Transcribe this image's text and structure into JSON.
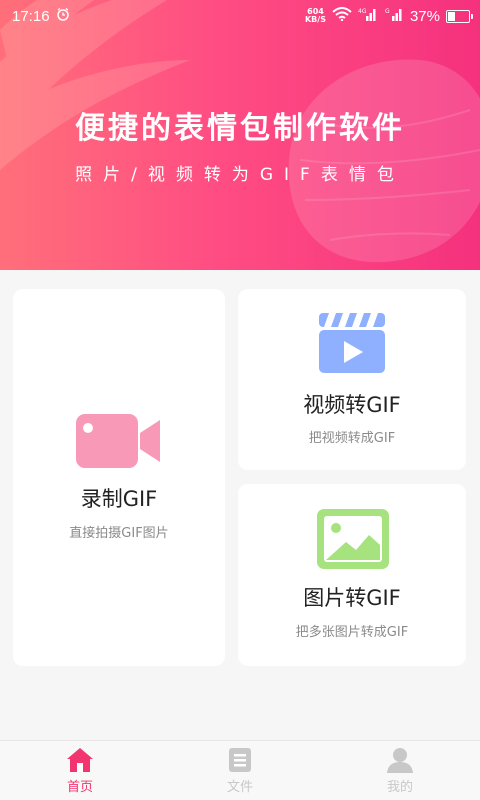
{
  "status_bar": {
    "time": "17:16",
    "net_speed_value": "604",
    "net_speed_unit": "KB/S",
    "signal_1_label": "4G",
    "signal_2_label": "G",
    "battery_percent": "37%",
    "battery_level": 0.37
  },
  "banner": {
    "title": "便捷的表情包制作软件",
    "subtitle": "照片/视频转为GIF表情包"
  },
  "cards": {
    "record": {
      "title": "录制GIF",
      "desc": "直接拍摄GIF图片",
      "icon": "video-camera-icon"
    },
    "video": {
      "title": "视频转GIF",
      "desc": "把视频转成GIF",
      "icon": "clapperboard-icon"
    },
    "image": {
      "title": "图片转GIF",
      "desc": "把多张图片转成GIF",
      "icon": "image-icon"
    }
  },
  "nav": {
    "home": "首页",
    "files": "文件",
    "mine": "我的"
  },
  "colors": {
    "accent": "#f2356f",
    "banner_start": "#ff6f7a",
    "banner_end": "#f5317e",
    "record_icon": "#f899b8",
    "video_icon": "#8fb0ff",
    "image_icon": "#a6e27d",
    "nav_inactive": "#c8c8c8"
  }
}
